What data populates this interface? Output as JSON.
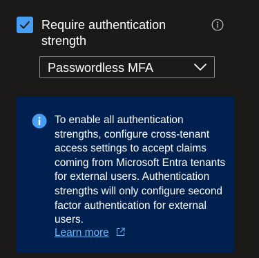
{
  "checkbox": {
    "checked": true,
    "label": "Require authentication strength",
    "accent_color": "#479ef5"
  },
  "info_icon": "info-circle-icon",
  "dropdown": {
    "value": "Passwordless MFA",
    "icon": "chevron-down-icon"
  },
  "info_box": {
    "background_color": "#002050",
    "icon": "info-filled-icon",
    "icon_color": "#479ef5",
    "text": "To enable all authentication strengths, configure cross-tenant access settings to accept claims coming from Microsoft Entra tenants for external users. Authentication strengths will only configure second factor authentication for external users.",
    "link_label": "Learn more",
    "link_color": "#6cb8f6",
    "link_icon": "external-link-icon"
  }
}
